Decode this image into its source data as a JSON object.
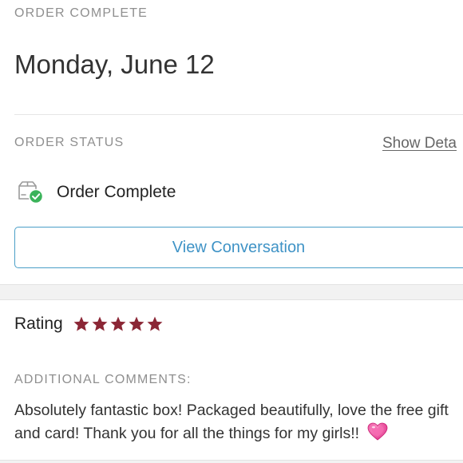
{
  "order": {
    "eyebrow": "ORDER COMPLETE",
    "date": "Monday, June 12"
  },
  "status": {
    "eyebrow": "ORDER STATUS",
    "show_details_label": "Show Deta",
    "status_icon": "package-check-icon",
    "status_text": "Order Complete",
    "view_conversation_label": "View Conversation"
  },
  "rating": {
    "label": "Rating",
    "stars": 5,
    "max_stars": 5,
    "star_color": "#8b2635"
  },
  "comments": {
    "eyebrow": "ADDITIONAL COMMENTS:",
    "text": "Absolutely fantastic box! Packaged beautifully, love the free gift and card! Thank you for all the things for my girls!!",
    "emoji_icon": "sparkling-heart-icon"
  },
  "colors": {
    "accent": "#3f93c6",
    "success": "#3bb35a",
    "star": "#8b2635"
  }
}
